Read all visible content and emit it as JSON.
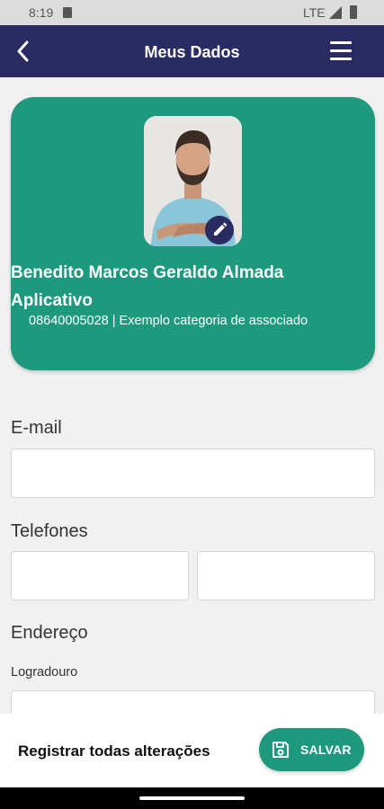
{
  "status_bar": {
    "time": "8:19",
    "network": "LTE"
  },
  "app_bar": {
    "title": "Meus Dados"
  },
  "profile": {
    "name": "Benedito Marcos Geraldo Almada Aplicativo",
    "subtitle": "08640005028 | Exemplo categoria de associado"
  },
  "form": {
    "email_label": "E-mail",
    "email_value": "",
    "phones_label": "Telefones",
    "phone1_value": "",
    "phone2_value": "",
    "address_label": "Endereço",
    "street_label": "Logradouro",
    "street_value": ""
  },
  "footer": {
    "register_label": "Registrar todas alterações",
    "save_label": "SALVAR"
  },
  "colors": {
    "accent": "#1f997d",
    "app_bar": "#2b2b63",
    "background": "#f1f1f1"
  }
}
